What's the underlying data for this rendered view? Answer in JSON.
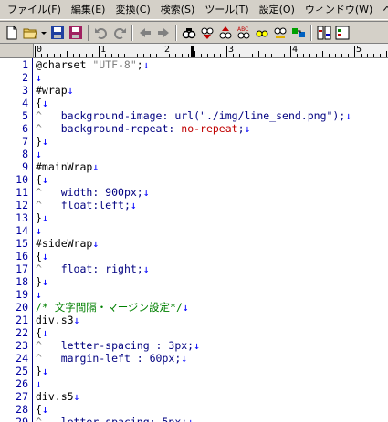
{
  "menu": {
    "file": "ファイル(F)",
    "edit": "編集(E)",
    "convert": "変換(C)",
    "search": "検索(S)",
    "tools": "ツール(T)",
    "settings": "設定(O)",
    "window": "ウィンドウ(W)",
    "more": "ヘ"
  },
  "ruler": {
    "labels": [
      "0",
      "1",
      "2",
      "3",
      "4",
      "5"
    ]
  },
  "colors": {
    "line_numbers": "#0000a0",
    "comment": "#008000",
    "value": "#c00000",
    "eol_mark": "#0000ff"
  },
  "editor": {
    "line_numbers": [
      "1",
      "2",
      "3",
      "4",
      "5",
      "6",
      "7",
      "8",
      "9",
      "10",
      "11",
      "12",
      "13",
      "14",
      "15",
      "16",
      "17",
      "18",
      "19",
      "20",
      "21",
      "22",
      "23",
      "24",
      "25",
      "26",
      "27",
      "28",
      "29"
    ],
    "lines": [
      [
        {
          "t": "@charset ",
          "c": "sel"
        },
        {
          "t": "\"UTF-8\"",
          "c": "str"
        },
        {
          "t": ";",
          "c": "sel"
        },
        {
          "t": "↓",
          "c": "eol"
        }
      ],
      [
        {
          "t": "↓",
          "c": "eol"
        }
      ],
      [
        {
          "t": "#wrap",
          "c": "sel"
        },
        {
          "t": "↓",
          "c": "eol"
        }
      ],
      [
        {
          "t": "{",
          "c": "sel"
        },
        {
          "t": "↓",
          "c": "eol"
        }
      ],
      [
        {
          "t": "^   ",
          "c": "tab"
        },
        {
          "t": "background-image: url(\"./img/line_send.png\");",
          "c": "prop"
        },
        {
          "t": "↓",
          "c": "eol"
        }
      ],
      [
        {
          "t": "^   ",
          "c": "tab"
        },
        {
          "t": "background-repeat: ",
          "c": "prop"
        },
        {
          "t": "no-repeat",
          "c": "val"
        },
        {
          "t": ";",
          "c": "prop"
        },
        {
          "t": "↓",
          "c": "eol"
        }
      ],
      [
        {
          "t": "}",
          "c": "sel"
        },
        {
          "t": "↓",
          "c": "eol"
        }
      ],
      [
        {
          "t": "↓",
          "c": "eol"
        }
      ],
      [
        {
          "t": "#mainWrap",
          "c": "sel"
        },
        {
          "t": "↓",
          "c": "eol"
        }
      ],
      [
        {
          "t": "{",
          "c": "sel"
        },
        {
          "t": "↓",
          "c": "eol"
        }
      ],
      [
        {
          "t": "^   ",
          "c": "tab"
        },
        {
          "t": "width: 900px;",
          "c": "prop"
        },
        {
          "t": "↓",
          "c": "eol"
        }
      ],
      [
        {
          "t": "^   ",
          "c": "tab"
        },
        {
          "t": "float:left;",
          "c": "prop"
        },
        {
          "t": "↓",
          "c": "eol"
        }
      ],
      [
        {
          "t": "}",
          "c": "sel"
        },
        {
          "t": "↓",
          "c": "eol"
        }
      ],
      [
        {
          "t": "↓",
          "c": "eol"
        }
      ],
      [
        {
          "t": "#sideWrap",
          "c": "sel"
        },
        {
          "t": "↓",
          "c": "eol"
        }
      ],
      [
        {
          "t": "{",
          "c": "sel"
        },
        {
          "t": "↓",
          "c": "eol"
        }
      ],
      [
        {
          "t": "^   ",
          "c": "tab"
        },
        {
          "t": "float: right;",
          "c": "prop"
        },
        {
          "t": "↓",
          "c": "eol"
        }
      ],
      [
        {
          "t": "}",
          "c": "sel"
        },
        {
          "t": "↓",
          "c": "eol"
        }
      ],
      [
        {
          "t": "↓",
          "c": "eol"
        }
      ],
      [
        {
          "t": "/* 文字間隔・マージン設定*/",
          "c": "cmt"
        },
        {
          "t": "↓",
          "c": "eol"
        }
      ],
      [
        {
          "t": "div.s3",
          "c": "sel"
        },
        {
          "t": "↓",
          "c": "eol"
        }
      ],
      [
        {
          "t": "{",
          "c": "sel"
        },
        {
          "t": "↓",
          "c": "eol"
        }
      ],
      [
        {
          "t": "^   ",
          "c": "tab"
        },
        {
          "t": "letter-spacing : 3px;",
          "c": "prop"
        },
        {
          "t": "↓",
          "c": "eol"
        }
      ],
      [
        {
          "t": "^   ",
          "c": "tab"
        },
        {
          "t": "margin-left : 60px;",
          "c": "prop"
        },
        {
          "t": "↓",
          "c": "eol"
        }
      ],
      [
        {
          "t": "}",
          "c": "sel"
        },
        {
          "t": "↓",
          "c": "eol"
        }
      ],
      [
        {
          "t": "↓",
          "c": "eol"
        }
      ],
      [
        {
          "t": "div.s5",
          "c": "sel"
        },
        {
          "t": "↓",
          "c": "eol"
        }
      ],
      [
        {
          "t": "{",
          "c": "sel"
        },
        {
          "t": "↓",
          "c": "eol"
        }
      ],
      [
        {
          "t": "^   ",
          "c": "tab"
        },
        {
          "t": "letter-spacing: 5px;",
          "c": "prop"
        },
        {
          "t": "↓",
          "c": "eol"
        }
      ]
    ]
  }
}
